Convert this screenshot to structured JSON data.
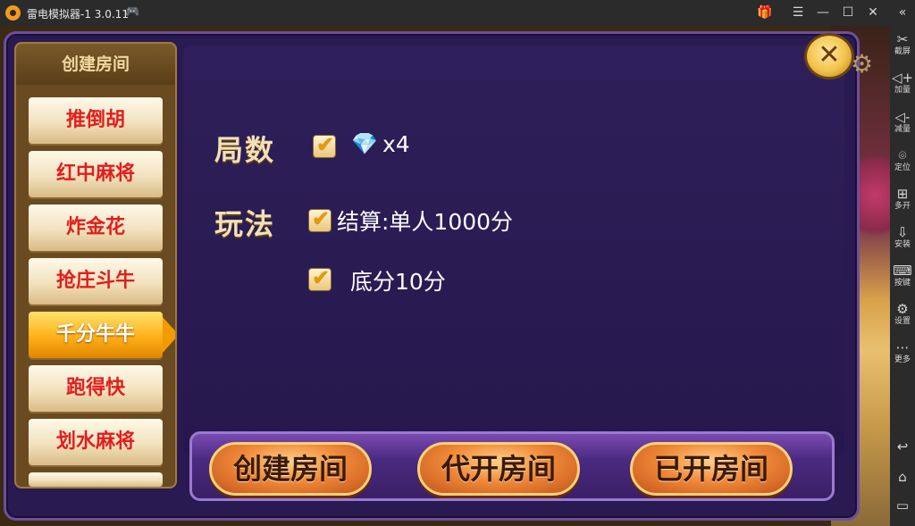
{
  "window": {
    "title": "雷电模拟器-1 3.0.11",
    "controls": [
      "gift-icon",
      "menu-icon",
      "minimize-icon",
      "maximize-icon",
      "close-icon",
      "collapse-icon"
    ]
  },
  "sidebar": {
    "items": [
      {
        "label": "截屏",
        "icon": "scissors-icon"
      },
      {
        "label": "加量",
        "icon": "volume-up-icon"
      },
      {
        "label": "减量",
        "icon": "volume-down-icon"
      },
      {
        "label": "定位",
        "icon": "location-icon"
      },
      {
        "label": "多开",
        "icon": "multi-instance-icon"
      },
      {
        "label": "安装",
        "icon": "install-apk-icon"
      },
      {
        "label": "按键",
        "icon": "keyboard-icon"
      },
      {
        "label": "设置",
        "icon": "settings-icon"
      },
      {
        "label": "更多",
        "icon": "more-icon"
      }
    ],
    "nav": [
      "back-icon",
      "home-icon",
      "recents-icon"
    ]
  },
  "menu": {
    "title": "创建房间",
    "items": [
      {
        "label": "推倒胡",
        "active": false
      },
      {
        "label": "红中麻将",
        "active": false
      },
      {
        "label": "炸金花",
        "active": false
      },
      {
        "label": "抢庄斗牛",
        "active": false
      },
      {
        "label": "千分牛牛",
        "active": true
      },
      {
        "label": "跑得快",
        "active": false
      },
      {
        "label": "划水麻将",
        "active": false
      }
    ]
  },
  "options": {
    "rounds_label": "局数",
    "rounds_value": "x4",
    "rules_label": "玩法",
    "rule1": "结算:单人1000分",
    "rule2": "底分10分"
  },
  "actions": {
    "create": "创建房间",
    "proxy": "代开房间",
    "opened": "已开房间"
  }
}
